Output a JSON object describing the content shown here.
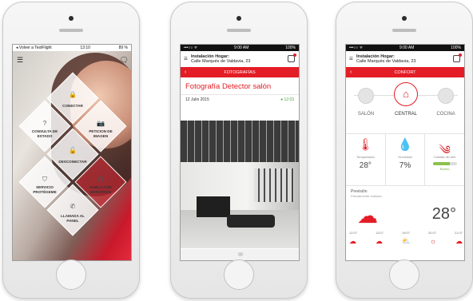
{
  "phones": [
    {
      "status": {
        "left": "◂ Volver a TestFlight",
        "time": "13:10",
        "right": "89 %"
      },
      "menu_icon": "hamburger-icon",
      "chat_icon": "speech-bubble-icon",
      "tiles": [
        {
          "label": "CONECTAR",
          "icon": "lock-icon"
        },
        {
          "label": "CONSULTA DE ESTADO",
          "icon": "question-icon"
        },
        {
          "label": "PETICION DE IMAGEN",
          "icon": "camera-icon"
        },
        {
          "label": "DESCONECTAR",
          "icon": "unlock-icon"
        },
        {
          "label": "SERVICIO PROTÉGEME",
          "icon": "shield-icon"
        },
        {
          "label": "HABLA CON NOSOTROS",
          "icon": "headset-icon"
        },
        {
          "label": "LLAMADA AL PANEL",
          "icon": "phone-icon"
        }
      ]
    },
    {
      "status": {
        "left": "•••○○ ᯤ",
        "time": "9:00 AM",
        "right": "100%"
      },
      "header": {
        "title": "Instalación Hogar:",
        "address": "Calle Marqués de Valdavia, 23"
      },
      "section": "FOTOGRAFÍAS",
      "photo_title": "Fotografía Detector salón",
      "date": "12 Julio 2015",
      "time": "● 12:03",
      "footer_icon": "envelope-icon"
    },
    {
      "status": {
        "left": "•••○○ ᯤ",
        "time": "9:00 AM",
        "right": "100%"
      },
      "header": {
        "title": "Instalación Hogar:",
        "address": "Calle Marqués de Valdavia, 23"
      },
      "section": "CONFORT",
      "rooms": [
        "SALÓN",
        "CENTRAL",
        "COCINA"
      ],
      "active_room": "CENTRAL",
      "metrics": [
        {
          "label": "Temperatura",
          "value": "28°",
          "icon": "thermometer-icon"
        },
        {
          "label": "Humedad",
          "value": "7%",
          "icon": "drop-icon"
        },
        {
          "label": "Calidad del aire",
          "value": "Bueno",
          "icon": "wind-icon",
          "level": 0.7
        }
      ],
      "forecast": {
        "title": "Previsión",
        "subtitle": "Parcialmente nublado",
        "temp": "28°",
        "times": [
          "12:07",
          "13:07",
          "19:07",
          "20:07",
          "21:07"
        ]
      },
      "accent": "#e31c25"
    }
  ]
}
